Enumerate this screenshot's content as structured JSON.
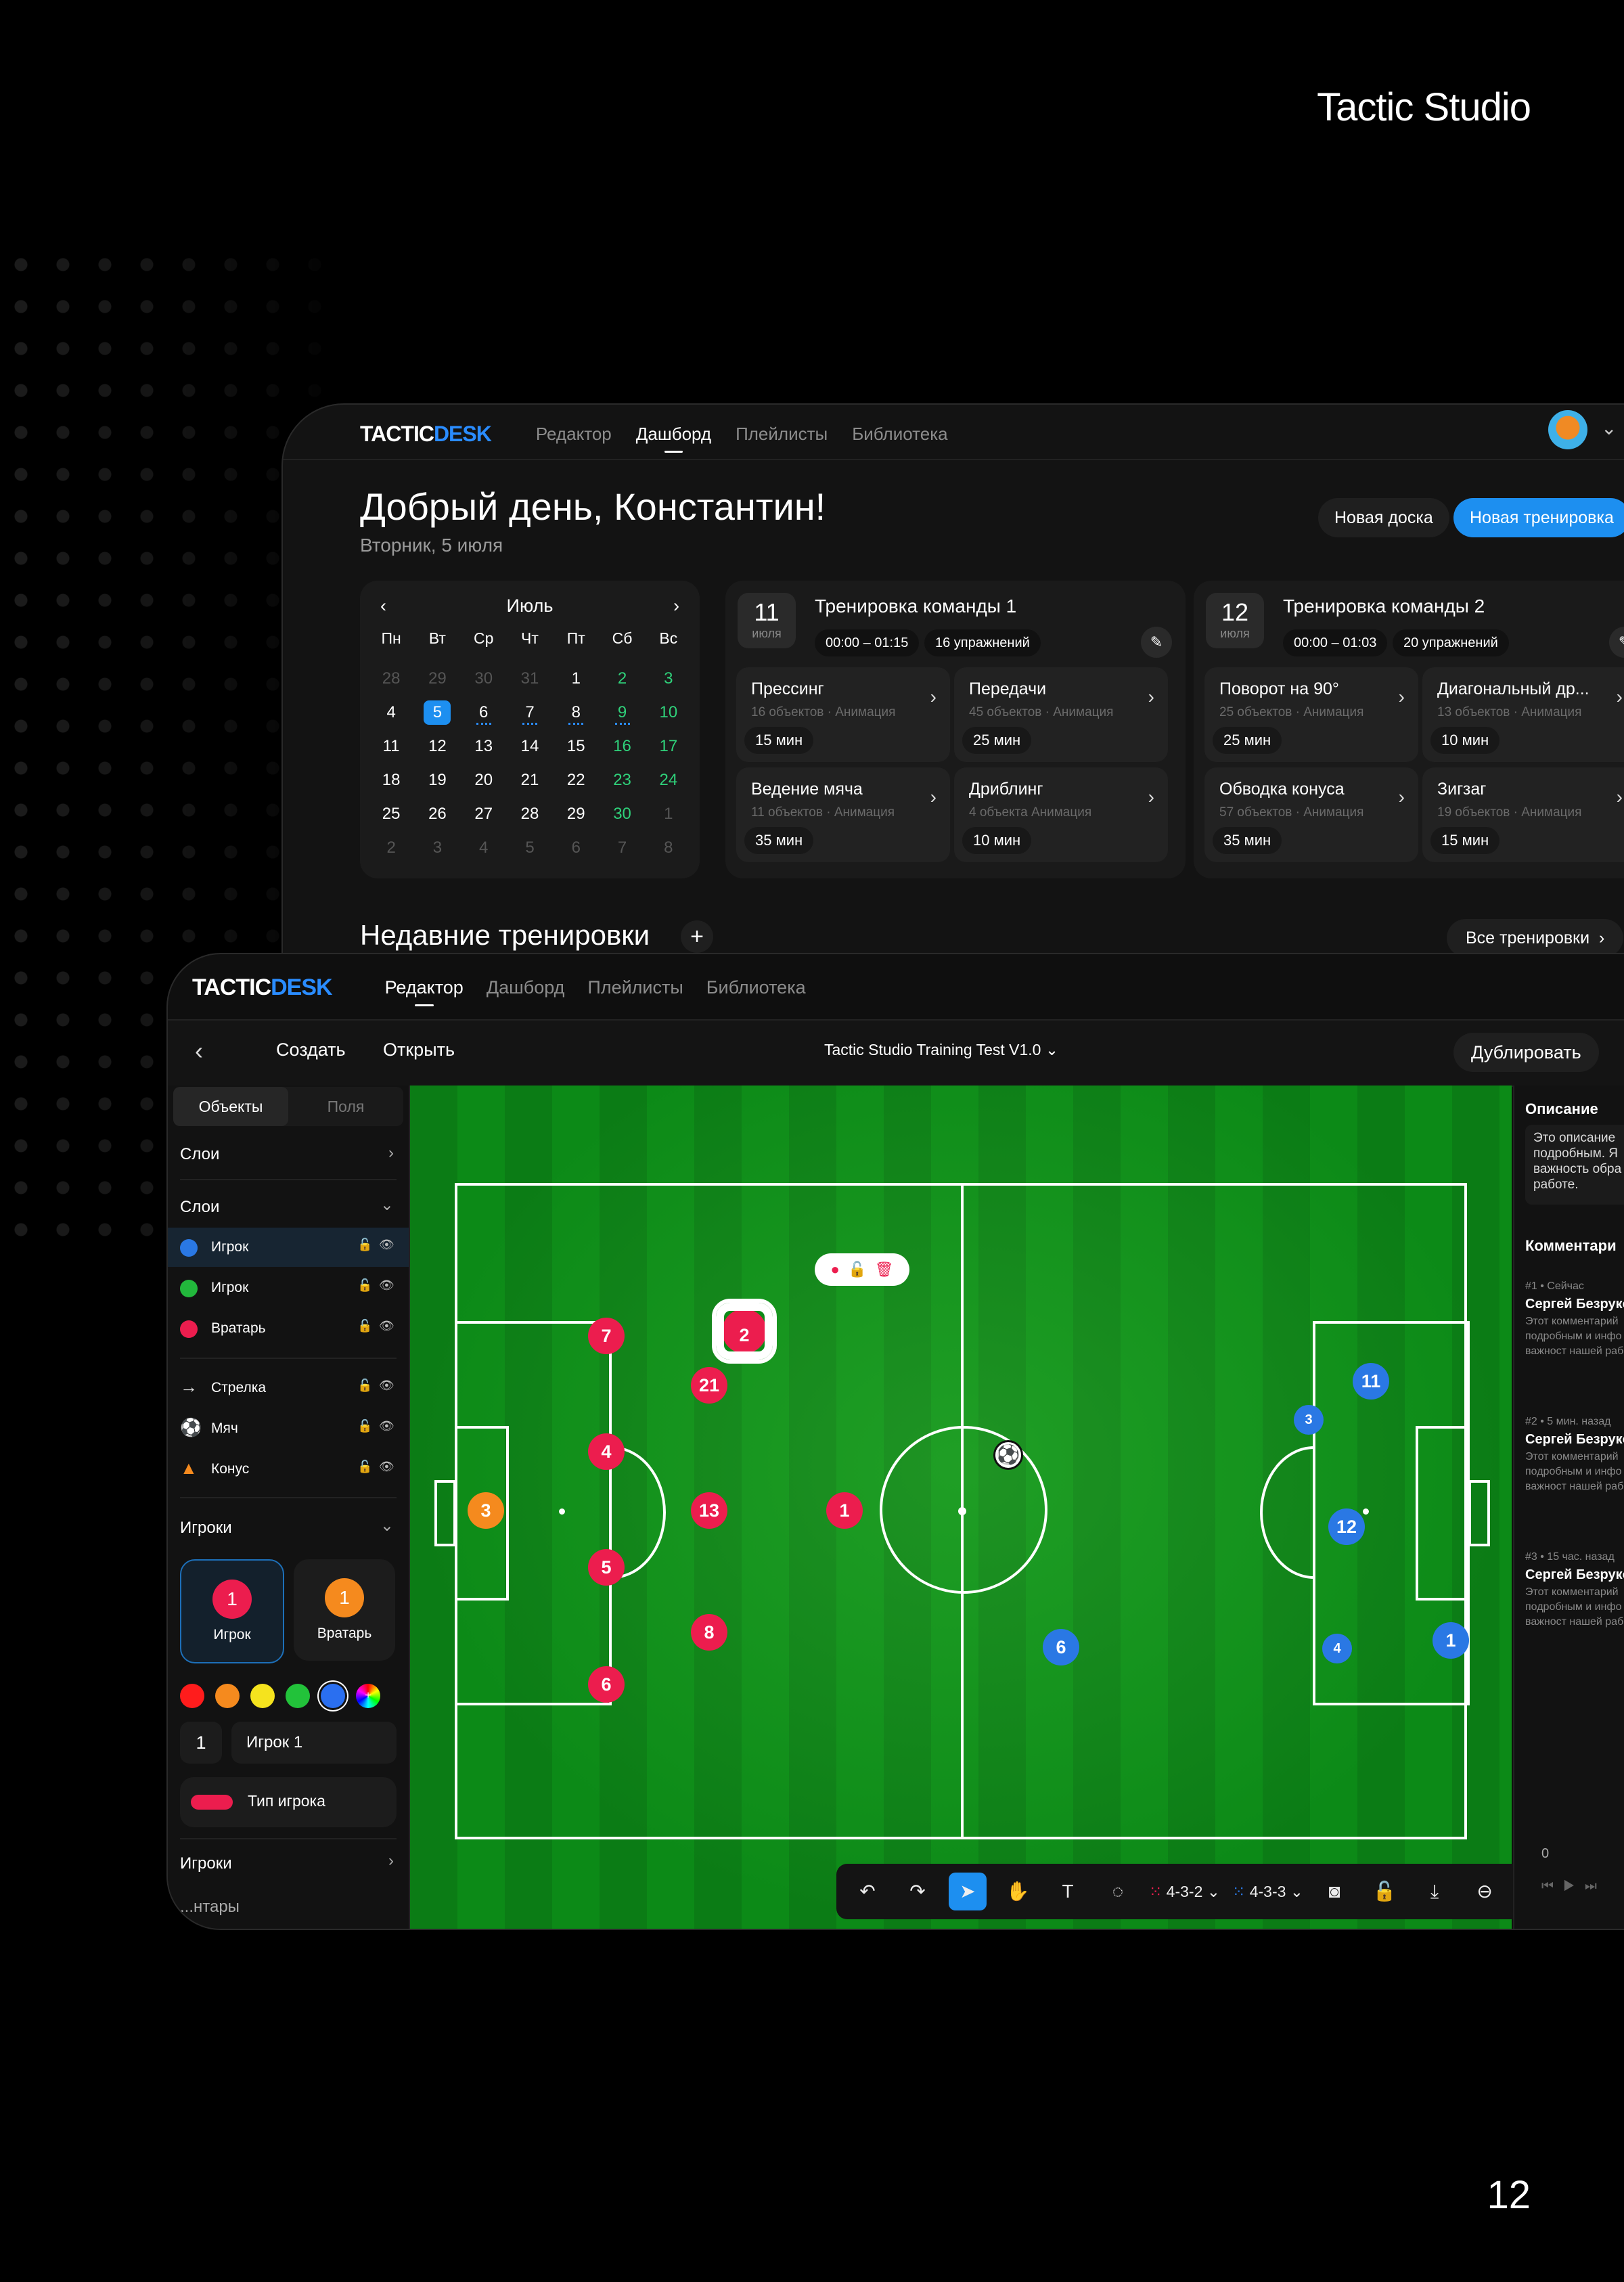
{
  "brand": "Tactic Studio",
  "page_number": "12",
  "logo": {
    "part1": "TACTIC",
    "part2": "DESK"
  },
  "dashboard": {
    "nav": [
      "Редактор",
      "Дашборд",
      "Плейлисты",
      "Библиотека"
    ],
    "active_nav": "Дашборд",
    "greeting": "Добрый день, Константин!",
    "date": "Вторник, 5 июля",
    "new_board": "Новая доска",
    "new_training": "Новая тренировка",
    "calendar": {
      "month": "Июль",
      "weekdays": [
        "Пн",
        "Вт",
        "Ср",
        "Чт",
        "Пт",
        "Сб",
        "Вс"
      ],
      "days": [
        [
          "28",
          "muted"
        ],
        [
          "29",
          "muted"
        ],
        [
          "30",
          "muted"
        ],
        [
          "31",
          "muted"
        ],
        [
          "1",
          ""
        ],
        [
          "2",
          "green"
        ],
        [
          "3",
          "green"
        ],
        [
          "4",
          ""
        ],
        [
          "5",
          "sel"
        ],
        [
          "6",
          "ev"
        ],
        [
          "7",
          "ev"
        ],
        [
          "8",
          "ev"
        ],
        [
          "9",
          "green ev"
        ],
        [
          "10",
          "green"
        ],
        [
          "11",
          ""
        ],
        [
          "12",
          ""
        ],
        [
          "13",
          ""
        ],
        [
          "14",
          ""
        ],
        [
          "15",
          ""
        ],
        [
          "16",
          "green"
        ],
        [
          "17",
          "green"
        ],
        [
          "18",
          ""
        ],
        [
          "19",
          ""
        ],
        [
          "20",
          ""
        ],
        [
          "21",
          ""
        ],
        [
          "22",
          ""
        ],
        [
          "23",
          "green"
        ],
        [
          "24",
          "green"
        ],
        [
          "25",
          ""
        ],
        [
          "26",
          ""
        ],
        [
          "27",
          ""
        ],
        [
          "28",
          ""
        ],
        [
          "29",
          ""
        ],
        [
          "30",
          "green"
        ],
        [
          "1",
          "muted"
        ],
        [
          "2",
          "muted"
        ],
        [
          "3",
          "muted"
        ],
        [
          "4",
          "muted"
        ],
        [
          "5",
          "muted"
        ],
        [
          "6",
          "muted"
        ],
        [
          "7",
          "muted"
        ],
        [
          "8",
          "muted"
        ]
      ]
    },
    "trainings": [
      {
        "day": "11",
        "month": "июля",
        "title": "Тренировка команды 1",
        "time": "00:00 – 01:15",
        "count": "16 упражнений",
        "exercises": [
          {
            "title": "Прессинг",
            "meta": "16 объектов · Анимация",
            "duration": "15 мин"
          },
          {
            "title": "Передачи",
            "meta": "45 объектов · Анимация",
            "duration": "25 мин"
          },
          {
            "title": "Ведение мяча",
            "meta": "11 объектов · Анимация",
            "duration": "35 мин"
          },
          {
            "title": "Дриблинг",
            "meta": "4 объекта Анимация",
            "duration": "10 мин"
          }
        ]
      },
      {
        "day": "12",
        "month": "июля",
        "title": "Тренировка команды 2",
        "time": "00:00 – 01:03",
        "count": "20 упражнений",
        "exercises": [
          {
            "title": "Поворот на 90°",
            "meta": "25 объектов · Анимация",
            "duration": "25 мин"
          },
          {
            "title": "Диагональный др...",
            "meta": "13 объектов · Анимация",
            "duration": "10 мин"
          },
          {
            "title": "Обводка конуса",
            "meta": "57 объектов · Анимация",
            "duration": "35 мин"
          },
          {
            "title": "Зигзаг",
            "meta": "19 объектов · Анимация",
            "duration": "15 мин"
          }
        ]
      }
    ],
    "recent": "Недавние тренировки",
    "all_trainings": "Все тренировки"
  },
  "editor": {
    "nav": [
      "Редактор",
      "Дашборд",
      "Плейлисты",
      "Библиотека"
    ],
    "active_nav": "Редактор",
    "create": "Создать",
    "open": "Открыть",
    "doc_title": "Tactic Studio Training Test V1.0",
    "duplicate": "Дублировать",
    "tabs": [
      "Объекты",
      "Поля"
    ],
    "section_layers": "Слои",
    "layers": [
      {
        "label": "Игрок",
        "color": "#2a78e4"
      },
      {
        "label": "Игрок",
        "color": "#22b83c"
      },
      {
        "label": "Вратарь",
        "color": "#ec1d4e"
      }
    ],
    "objects": [
      {
        "label": "Стрелка",
        "icon": "→"
      },
      {
        "label": "Мяч",
        "icon": "⚽"
      },
      {
        "label": "Конус",
        "icon": "▲"
      }
    ],
    "section_players": "Игроки",
    "player_types": [
      {
        "num": "1",
        "label": "Игрок",
        "color": "#ec1d4e"
      },
      {
        "num": "1",
        "label": "Вратарь",
        "color": "#f58a1e"
      }
    ],
    "swatches": [
      "#ff1c1c",
      "#f58a1e",
      "#f5e31e",
      "#22c23a",
      "#2a6ff0"
    ],
    "player_number": "1",
    "player_name": "Игрок 1",
    "player_type": "Тип игрока",
    "section_players2": "Игроки",
    "section_partial": "...нтары",
    "formations": [
      "4-3-2",
      "4-3-3"
    ],
    "description_title": "Описание",
    "description_text": "Это описание подробным. Я важность обра нашей работе.",
    "comments_title": "Комментари",
    "comments": [
      {
        "meta": "#1 • Сейчас",
        "author": "Сергей Безрукo",
        "text": "Этот комментарий подробным и инфо обсудить важност нашей работе."
      },
      {
        "meta": "#2 • 5 мин. назад",
        "author": "Сергей Безрукo",
        "text": "Этот комментарий подробным и инфо обсудить важност нашей работе."
      },
      {
        "meta": "#3 • 15 час. назад",
        "author": "Сергей Безрукo",
        "text": "Этот комментарий подробным и инфо обсудить важност нашей работе."
      }
    ],
    "timeline_start": "0",
    "players": [
      {
        "num": "7",
        "team": "red"
      },
      {
        "num": "21",
        "team": "red"
      },
      {
        "num": "2",
        "team": "red"
      },
      {
        "num": "4",
        "team": "red"
      },
      {
        "num": "13",
        "team": "red"
      },
      {
        "num": "1",
        "team": "red"
      },
      {
        "num": "5",
        "team": "red"
      },
      {
        "num": "8",
        "team": "red"
      },
      {
        "num": "6",
        "team": "red"
      },
      {
        "num": "3",
        "team": "orange"
      },
      {
        "num": "6",
        "team": "blue"
      },
      {
        "num": "11",
        "team": "blue"
      },
      {
        "num": "12",
        "team": "blue"
      },
      {
        "num": "1",
        "team": "blue"
      },
      {
        "num": "3",
        "team": "blue"
      },
      {
        "num": "4",
        "team": "blue"
      }
    ]
  }
}
